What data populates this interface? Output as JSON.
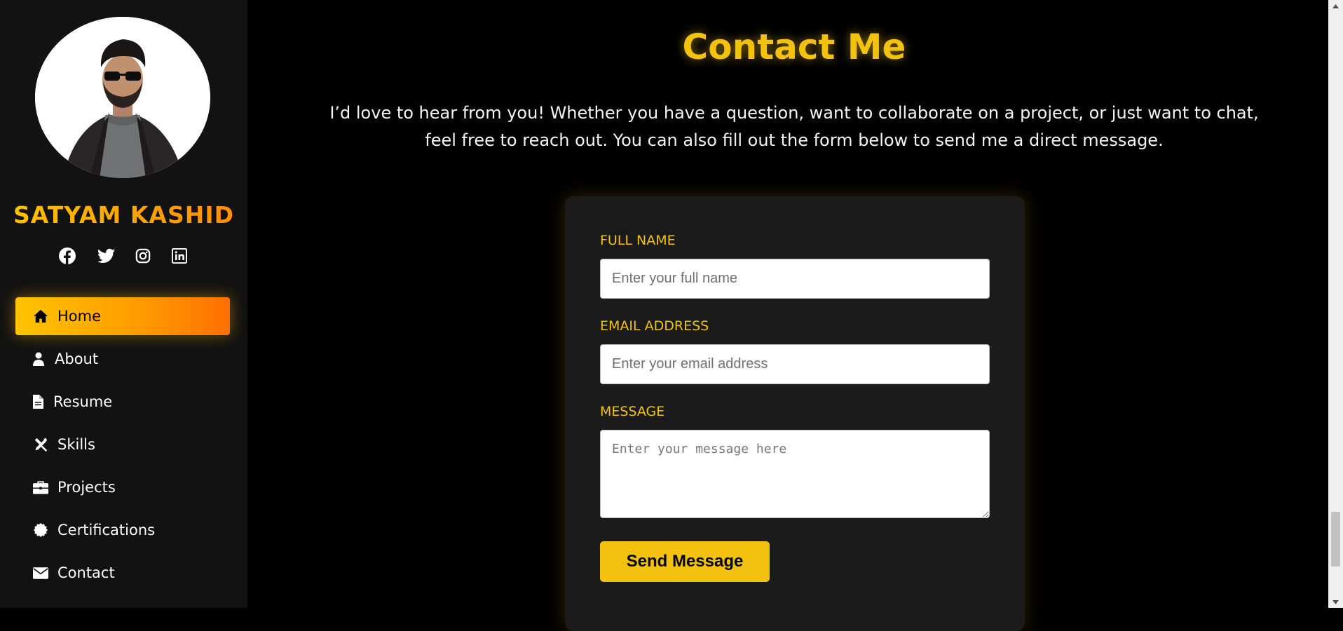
{
  "sidebar": {
    "name": "SATYAM KASHID",
    "socials": [
      {
        "icon": "facebook-icon"
      },
      {
        "icon": "twitter-icon"
      },
      {
        "icon": "instagram-icon"
      },
      {
        "icon": "linkedin-icon"
      }
    ],
    "nav": [
      {
        "label": "Home",
        "icon": "home-icon",
        "active": true
      },
      {
        "label": "About",
        "icon": "user-icon",
        "active": false
      },
      {
        "label": "Resume",
        "icon": "file-icon",
        "active": false
      },
      {
        "label": "Skills",
        "icon": "tools-icon",
        "active": false
      },
      {
        "label": "Projects",
        "icon": "briefcase-icon",
        "active": false
      },
      {
        "label": "Certifications",
        "icon": "certificate-icon",
        "active": false
      },
      {
        "label": "Contact",
        "icon": "envelope-icon",
        "active": false
      }
    ]
  },
  "main": {
    "title": "Contact Me",
    "intro_line1": "I’d love to hear from you! Whether you have a question, want to collaborate on a project, or just want to chat,",
    "intro_line2": "feel free to reach out. You can also fill out the form below to send me a direct message."
  },
  "form": {
    "full_name": {
      "label": "FULL NAME",
      "placeholder": "Enter your full name",
      "value": ""
    },
    "email": {
      "label": "EMAIL ADDRESS",
      "placeholder": "Enter your email address",
      "value": ""
    },
    "message": {
      "label": "MESSAGE",
      "placeholder": "Enter your message here",
      "value": ""
    },
    "submit_label": "Send Message"
  },
  "colors": {
    "accent": "#f2c20f",
    "accent_orange": "#ff8c00",
    "sidebar_bg": "#121212",
    "card_bg": "#1b1b1b",
    "page_bg": "#000000"
  }
}
